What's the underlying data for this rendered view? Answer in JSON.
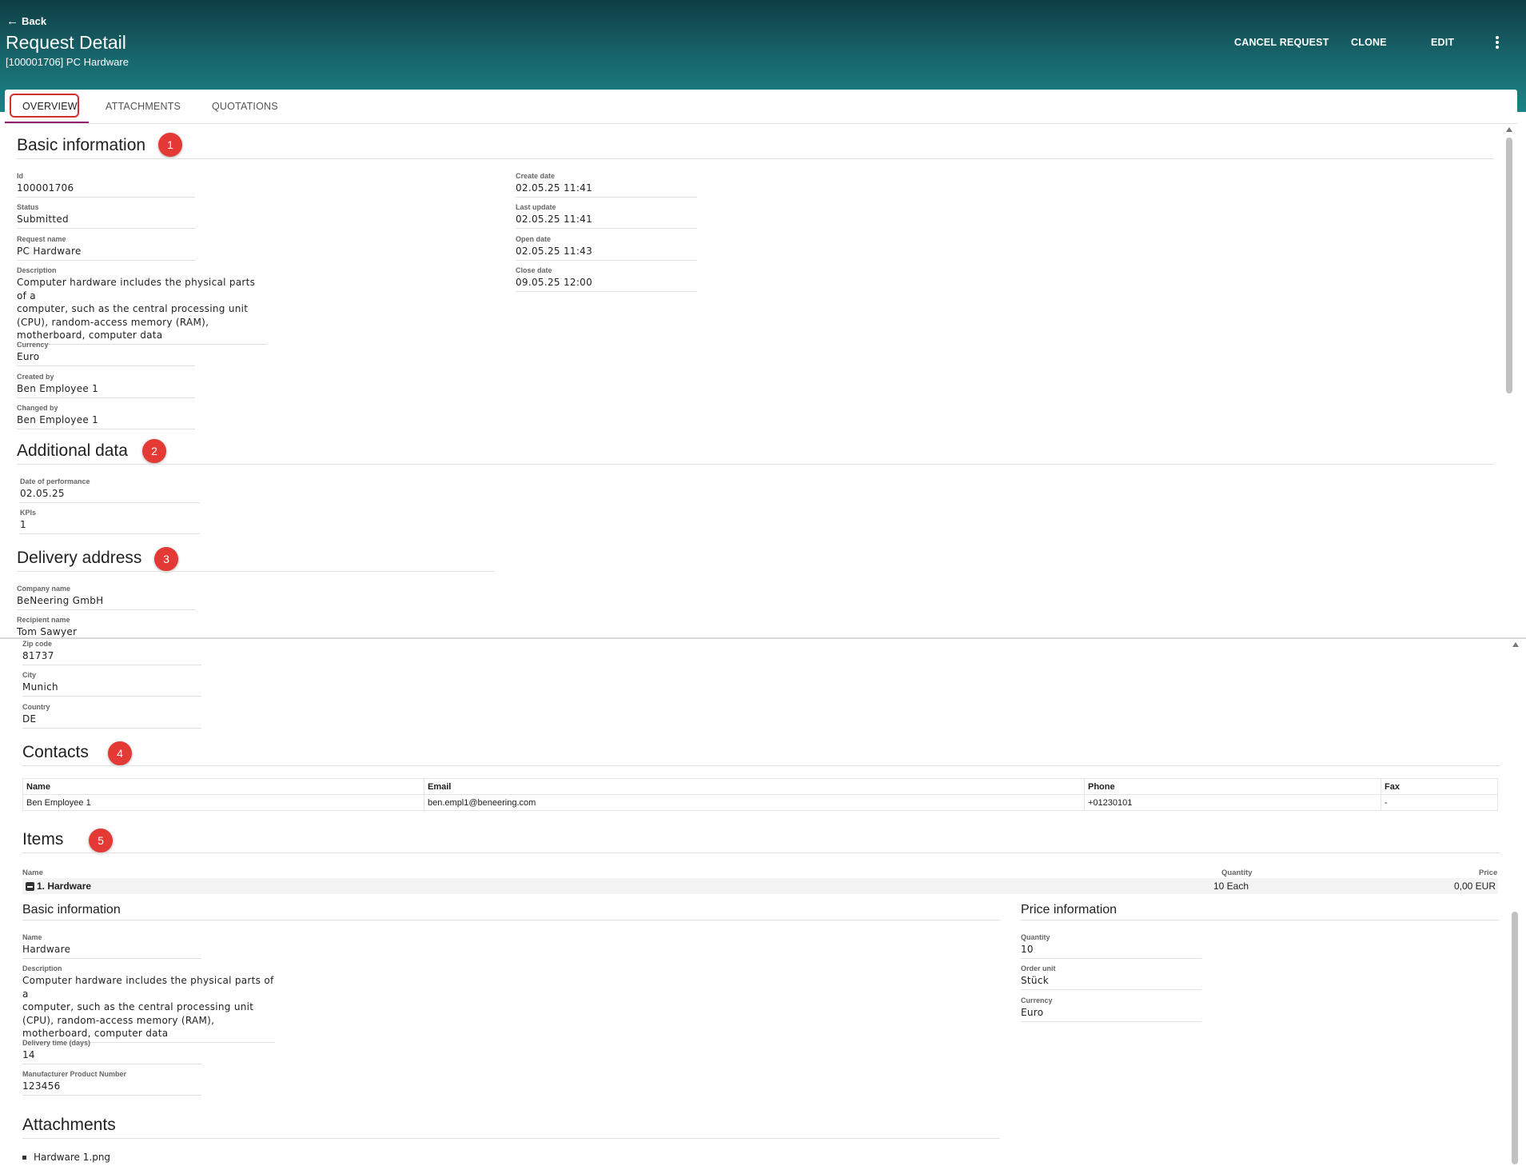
{
  "header": {
    "back_label": "Back",
    "title": "Request Detail",
    "subtitle": "[100001706] PC Hardware",
    "actions": {
      "cancel": "CANCEL REQUEST",
      "clone": "CLONE",
      "edit": "EDIT"
    }
  },
  "tabs": [
    {
      "label": "OVERVIEW",
      "active": true
    },
    {
      "label": "ATTACHMENTS",
      "active": false
    },
    {
      "label": "QUOTATIONS",
      "active": false
    }
  ],
  "badges": [
    "1",
    "2",
    "3",
    "4",
    "5"
  ],
  "basic": {
    "title": "Basic information",
    "id": {
      "label": "Id",
      "value": "100001706"
    },
    "status": {
      "label": "Status",
      "value": "Submitted"
    },
    "request_name": {
      "label": "Request name",
      "value": "PC Hardware"
    },
    "description": {
      "label": "Description",
      "lines": [
        "Computer hardware includes the physical parts of a",
        "computer, such as the central processing unit",
        "(CPU), random-access memory (RAM),",
        "motherboard, computer data"
      ]
    },
    "currency": {
      "label": "Currency",
      "value": "Euro"
    },
    "created_by": {
      "label": "Created by",
      "value": "Ben Employee 1"
    },
    "changed_by": {
      "label": "Changed by",
      "value": "Ben Employee 1"
    },
    "create_date": {
      "label": "Create date",
      "value": "02.05.25 11:41"
    },
    "last_update": {
      "label": "Last update",
      "value": "02.05.25 11:41"
    },
    "open_date": {
      "label": "Open date",
      "value": "02.05.25 11:43"
    },
    "close_date": {
      "label": "Close date",
      "value": "09.05.25 12:00"
    }
  },
  "additional": {
    "title": "Additional data",
    "date_of_performance": {
      "label": "Date of performance",
      "value": "02.05.25"
    },
    "kpis": {
      "label": "KPIs",
      "value": "1"
    }
  },
  "delivery": {
    "title": "Delivery address",
    "company_name": {
      "label": "Company name",
      "value": "BeNeering GmbH"
    },
    "recipient_name": {
      "label": "Recipient name",
      "value": "Tom Sawyer"
    },
    "zip_code": {
      "label": "Zip code",
      "value": "81737"
    },
    "city": {
      "label": "City",
      "value": "Munich"
    },
    "country": {
      "label": "Country",
      "value": "DE"
    }
  },
  "contacts": {
    "title": "Contacts",
    "columns": [
      "Name",
      "Email",
      "Phone",
      "Fax"
    ],
    "rows": [
      [
        "Ben Employee 1",
        "ben.empl1@beneering.com",
        "+01230101",
        "-"
      ]
    ]
  },
  "items": {
    "title": "Items",
    "columns": {
      "name": "Name",
      "quantity": "Quantity",
      "price": "Price"
    },
    "row": {
      "name": "1. Hardware",
      "quantity": "10 Each",
      "price": "0,00 EUR"
    },
    "basic": {
      "title": "Basic information",
      "name": {
        "label": "Name",
        "value": "Hardware"
      },
      "description": {
        "label": "Description",
        "lines": [
          "Computer hardware includes the physical parts of a",
          "computer, such as the central processing unit",
          "(CPU), random-access memory (RAM),",
          "motherboard, computer data"
        ]
      },
      "delivery_time": {
        "label": "Delivery time (days)",
        "value": "14"
      },
      "mpn": {
        "label": "Manufacturer Product Number",
        "value": "123456"
      }
    },
    "price": {
      "title": "Price information",
      "quantity": {
        "label": "Quantity",
        "value": "10"
      },
      "order_unit": {
        "label": "Order unit",
        "value": "Stück"
      },
      "currency": {
        "label": "Currency",
        "value": "Euro"
      }
    },
    "attachments": {
      "title": "Attachments",
      "files": [
        "Hardware 1.png"
      ]
    }
  },
  "colors": {
    "badge": "#e53935",
    "tab_underline": "#8e1f6e",
    "tab_highlight": "#d32f2f",
    "header_top": "#0f3e45",
    "header_bottom": "#1b8486"
  }
}
